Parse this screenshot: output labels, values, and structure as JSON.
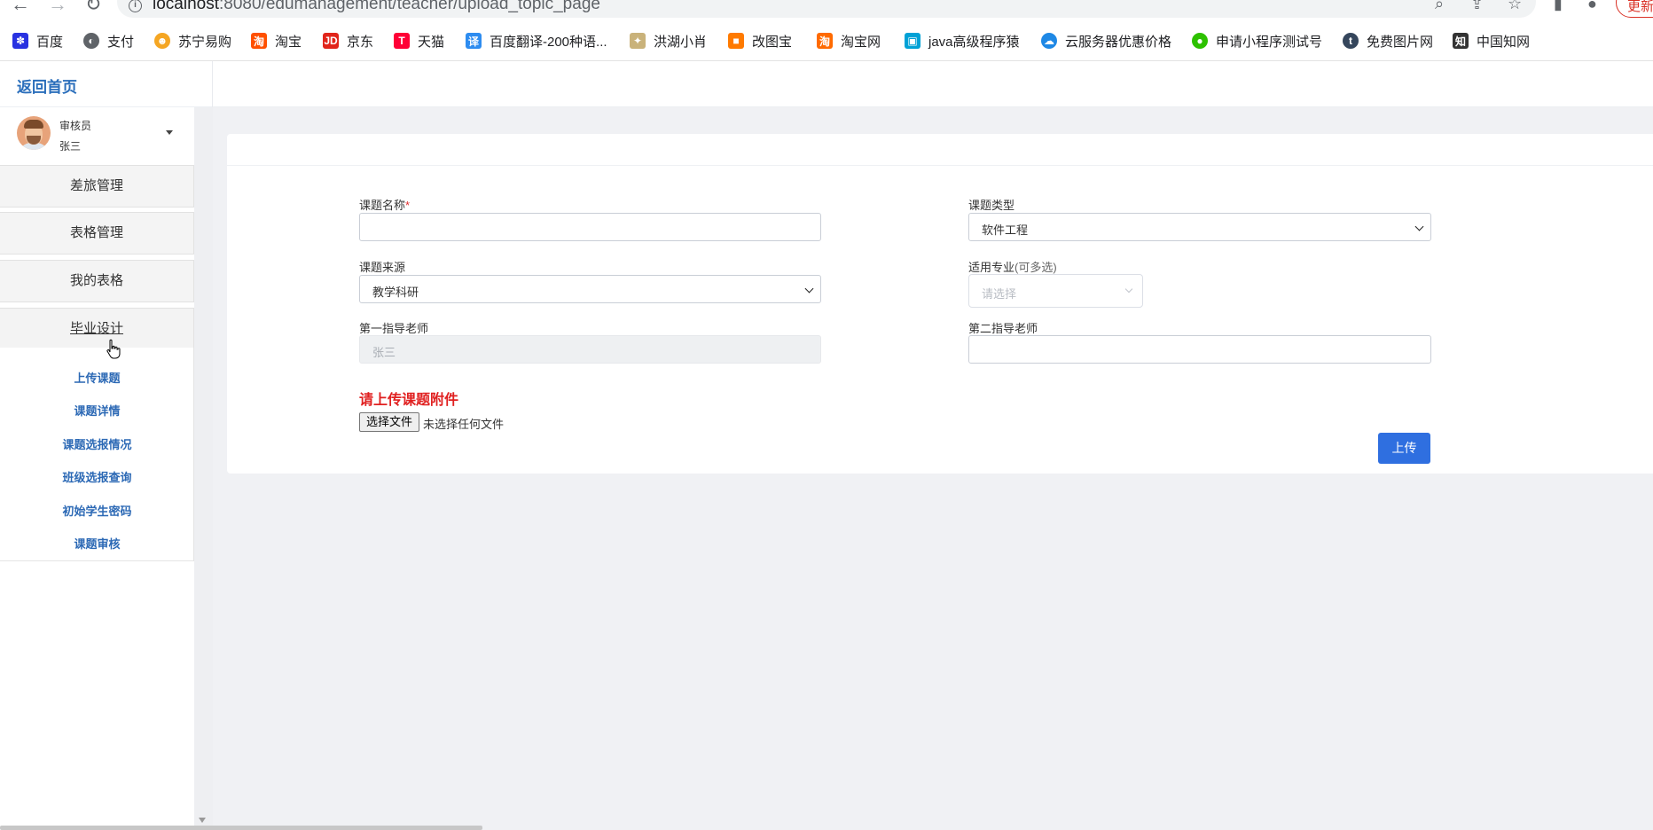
{
  "browser": {
    "url_host": "localhost",
    "url_path": ":8080/edumanagement/teacher/upload_topic_page",
    "update_label": "更新",
    "bookmarks": [
      {
        "label": "百度",
        "icon": "baidu-icon",
        "color": "#2932e1"
      },
      {
        "label": "支付",
        "icon": "globe-icon",
        "color": "#5f6368"
      },
      {
        "label": "苏宁易购",
        "icon": "suning-icon",
        "color": "#f5a623"
      },
      {
        "label": "淘宝",
        "icon": "taobao-icon",
        "color": "#ff5000"
      },
      {
        "label": "京东",
        "icon": "jd-icon",
        "color": "#e1251b"
      },
      {
        "label": "天猫",
        "icon": "tmall-icon",
        "color": "#ff0036"
      },
      {
        "label": "百度翻译-200种语...",
        "icon": "translate-icon",
        "color": "#2d8cf0"
      },
      {
        "label": "洪湖小肖",
        "icon": "bird-icon",
        "color": "#8a6d3b"
      },
      {
        "label": "改图宝",
        "icon": "gaitubao-icon",
        "color": "#ff7a00"
      },
      {
        "label": "淘宝网",
        "icon": "taobao-icon",
        "color": "#ff6a00"
      },
      {
        "label": "java高级程序猿",
        "icon": "bilibili-icon",
        "color": "#00a1d6"
      },
      {
        "label": "云服务器优惠价格",
        "icon": "cloud-icon",
        "color": "#1e88e5"
      },
      {
        "label": "申请小程序测试号",
        "icon": "wechat-icon",
        "color": "#2dc100"
      },
      {
        "label": "免费图片网",
        "icon": "tumblr-icon",
        "color": "#35465c"
      },
      {
        "label": "中国知网",
        "icon": "cnki-icon",
        "color": "#333333"
      }
    ]
  },
  "header": {
    "home_link": "返回首页"
  },
  "profile": {
    "role": "审核员",
    "name": "张三"
  },
  "sidebar": {
    "menu": [
      "差旅管理",
      "表格管理",
      "我的表格",
      "毕业设计"
    ],
    "submenu": [
      "上传课题",
      "课题详情",
      "课题选报情况",
      "班级选报查询",
      "初始学生密码",
      "课题审核"
    ]
  },
  "form": {
    "topic_name": {
      "label": "课题名称",
      "required_mark": "*",
      "value": ""
    },
    "topic_type": {
      "label": "课题类型",
      "value": "软件工程"
    },
    "topic_source": {
      "label": "课题来源",
      "value": "教学科研"
    },
    "majors": {
      "label": "适用专业",
      "hint": "(可多选)",
      "placeholder": "请选择"
    },
    "first_advisor": {
      "label": "第一指导老师",
      "value": "张三"
    },
    "second_advisor": {
      "label": "第二指导老师",
      "value": ""
    },
    "upload_title": "请上传课题附件",
    "file_button": "选择文件",
    "file_status": "未选择任何文件",
    "submit": "上传"
  },
  "colors": {
    "accent": "#2f6fe0",
    "link": "#2c69b5",
    "warning": "#e02020"
  }
}
